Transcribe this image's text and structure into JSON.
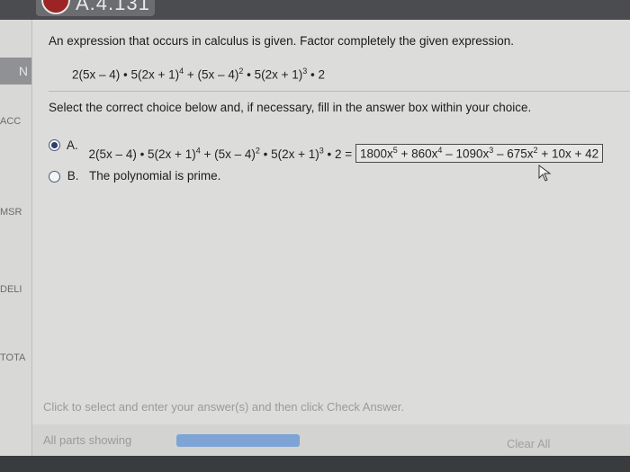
{
  "header": {
    "title": "A.4.131"
  },
  "sidebar": {
    "nav_letter": "N",
    "labels": [
      "ACC",
      "MSR",
      "DELI",
      "TOTA"
    ]
  },
  "question": {
    "prompt": "An expression that occurs in calculus is given. Factor completely the given expression.",
    "expr": [
      "2(5x – 4) • 5(2x + 1)",
      "4",
      " + (5x – 4)",
      "2",
      " • 5(2x + 1)",
      "3",
      " • 2"
    ]
  },
  "instructions": "Select the correct choice below and, if necessary, fill in the answer box within your choice.",
  "choices": {
    "a": {
      "letter": "A.",
      "expr": [
        "2(5x – 4) • 5(2x + 1)",
        "4",
        " + (5x – 4)",
        "2",
        " • 5(2x + 1)",
        "3",
        " • 2 ="
      ],
      "answer": [
        "1800x",
        "5",
        " + 860x",
        "4",
        " – 1090x",
        "3",
        " – 675x",
        "2",
        " + 10x + 42"
      ],
      "selected": true
    },
    "b": {
      "letter": "B.",
      "text": "The polynomial is prime.",
      "selected": false
    }
  },
  "hint": "Click to select and enter your answer(s) and then click Check Answer.",
  "footer": {
    "all_parts": "All parts showing",
    "clear_all": "Clear All",
    "progress_fraction": 1.0
  },
  "colors": {
    "radio_fill": "#2c3f6e",
    "progress": "#7da4d4"
  }
}
